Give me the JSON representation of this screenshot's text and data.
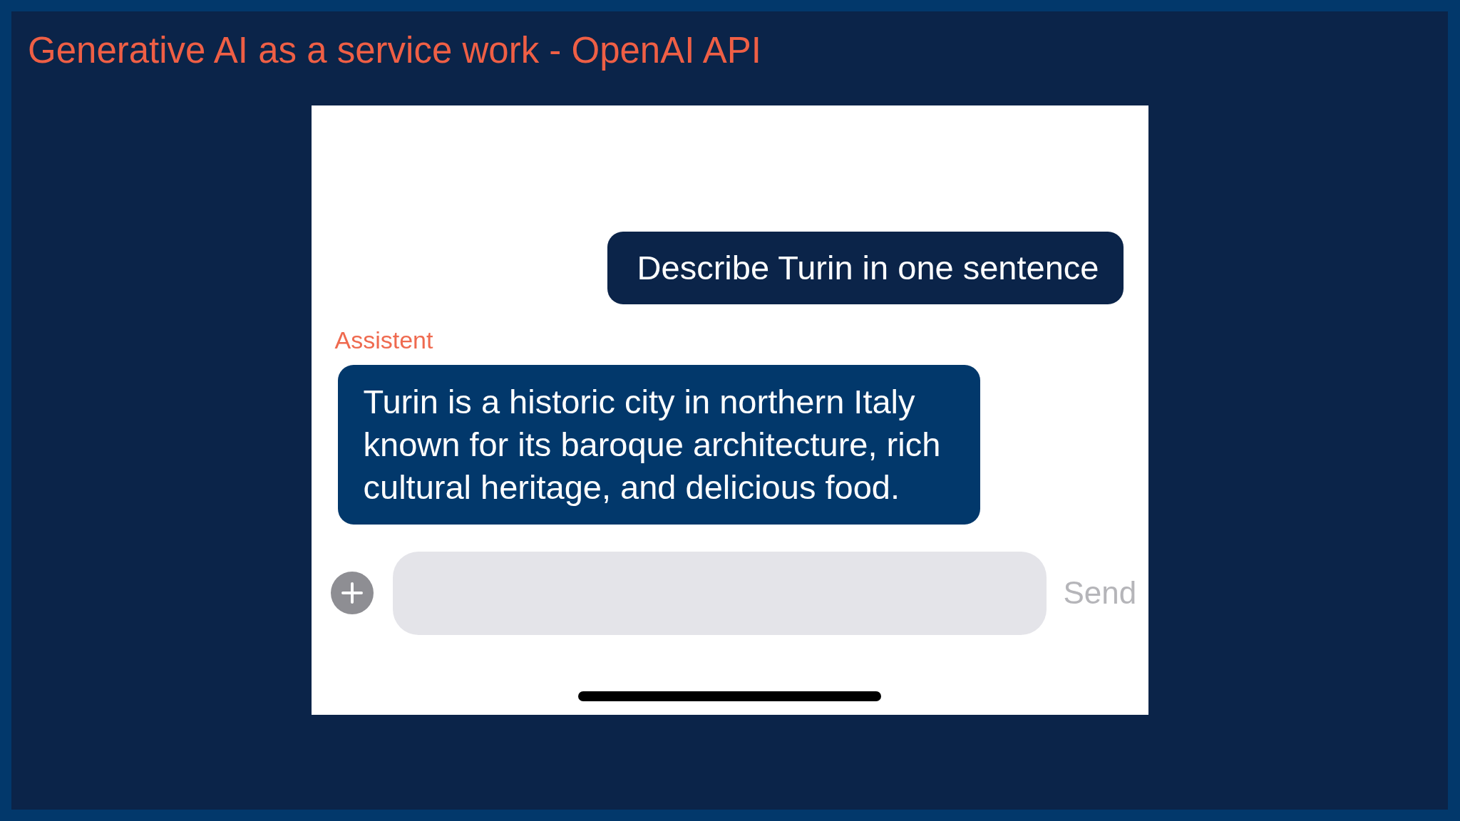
{
  "slide": {
    "title": "Generative AI as a service work - OpenAI API"
  },
  "chat": {
    "messages": [
      {
        "kind": "user",
        "text": "Describe Turin in one sentence"
      },
      {
        "kind": "assistant",
        "sender": "Assistent",
        "text": "Turin is a historic city in northern Italy known for its baroque architecture, rich cultural heritage, and delicious food."
      }
    ],
    "composer": {
      "send": {
        "label": "Send",
        "disabled": true
      }
    }
  }
}
